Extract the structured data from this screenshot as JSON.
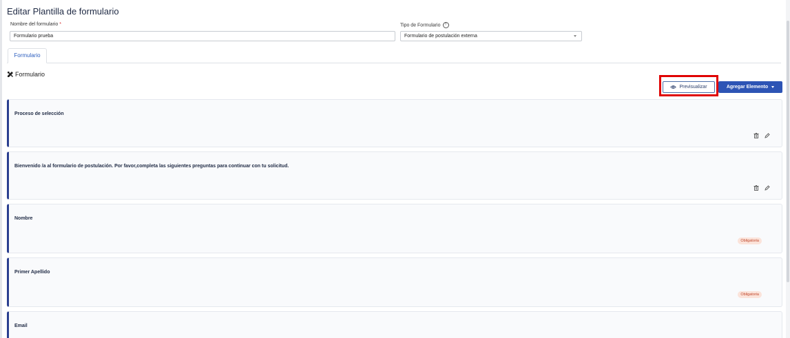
{
  "page": {
    "title": "Editar Plantilla de formulario"
  },
  "form": {
    "name_label": "Nombre del formulario",
    "name_required_mark": "*",
    "name_value": "Formulario prueba",
    "type_label": "Tipo de Formulario",
    "type_help_icon": "?",
    "type_value": "Formulario de postulación externa"
  },
  "tabs": [
    {
      "label": "Formulario"
    }
  ],
  "section": {
    "icon": "tools-icon",
    "title": "Formulario"
  },
  "toolbar": {
    "preview_label": "Previsualizar",
    "preview_icon": "eye-icon",
    "add_label": "Agregar Elemento"
  },
  "cards": [
    {
      "title": "Proceso de selección",
      "actions": [
        "trash-icon",
        "pencil-icon"
      ]
    },
    {
      "title": "Bienvenido /a al formulario de postulación. Por favor,completa las siguientes preguntas para continuar con tu solicitud.",
      "actions": [
        "trash-icon",
        "pencil-icon"
      ]
    },
    {
      "title": "Nombre",
      "badge": "Obligatoria"
    },
    {
      "title": "Primer Apellido",
      "badge": "Obligatoria"
    },
    {
      "title": "Email"
    }
  ],
  "colors": {
    "accent": "#2d54b5",
    "card_border": "#2a3e8f",
    "highlight": "#e00000",
    "badge_bg": "#fbe3da",
    "badge_text": "#c0472c"
  }
}
